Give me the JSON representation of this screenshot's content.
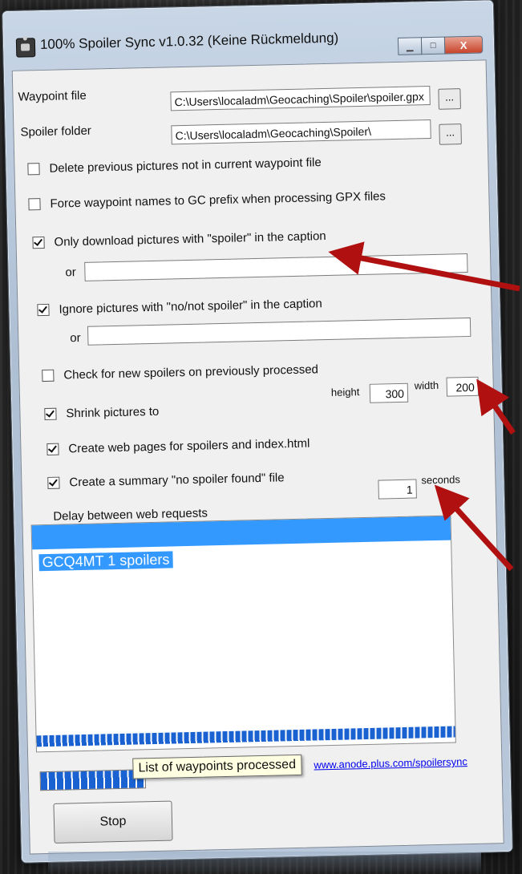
{
  "window": {
    "title": "100% Spoiler Sync v1.0.32 (Keine Rückmeldung)",
    "minimize_glyph": "▁",
    "maximize_glyph": "□",
    "close_glyph": "X"
  },
  "fields": {
    "waypoint_label": "Waypoint file",
    "waypoint_value": "C:\\Users\\localadm\\Geocaching\\Spoiler\\spoiler.gpx",
    "spoiler_label": "Spoiler folder",
    "spoiler_value": "C:\\Users\\localadm\\Geocaching\\Spoiler\\",
    "browse_label": "..."
  },
  "options": {
    "delete_previous": {
      "label": "Delete previous pictures not in current waypoint file",
      "checked": false
    },
    "force_gc": {
      "label": "Force waypoint names to GC prefix when processing GPX files",
      "checked": false
    },
    "only_spoiler": {
      "label": "Only download pictures with \"spoiler\" in the caption",
      "checked": true,
      "or_label": "or",
      "or_value": ""
    },
    "ignore_spoiler": {
      "label": "Ignore pictures with \"no/not spoiler\" in the caption",
      "checked": true,
      "or_label": "or",
      "or_value": ""
    },
    "check_new": {
      "label": "Check for new spoilers on previously processed",
      "checked": false
    },
    "shrink": {
      "label": "Shrink pictures to",
      "checked": true,
      "height_label": "height",
      "height_value": "300",
      "width_label": "width",
      "width_value": "200"
    },
    "web_pages": {
      "label": "Create web pages for spoilers and index.html",
      "checked": true
    },
    "summary": {
      "label": "Create a summary \"no spoiler found\" file",
      "checked": true
    }
  },
  "delay": {
    "label": "Delay between web requests",
    "value": "1",
    "unit": "seconds"
  },
  "list": {
    "items": [
      "GCQ4MT 1 spoilers"
    ],
    "tooltip": "List of waypoints processed",
    "progress_fraction": 1.0
  },
  "footer": {
    "link": "www.anode.plus.com/spoilersync",
    "stop_label": "Stop",
    "bottom_progress_fraction": 0.25
  },
  "colors": {
    "selection": "#3399ff",
    "progress": "#1a62d1",
    "arrow": "#b01010"
  }
}
